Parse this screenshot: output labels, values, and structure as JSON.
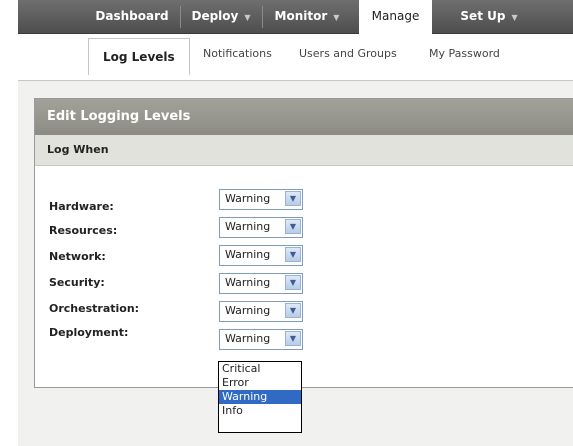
{
  "topnav": {
    "items": [
      {
        "label": "Dashboard",
        "arrow": ""
      },
      {
        "label": "Deploy",
        "arrow": "▼"
      },
      {
        "label": "Monitor",
        "arrow": "▼"
      },
      {
        "label": "Manage",
        "arrow": ""
      },
      {
        "label": "Set Up",
        "arrow": "▼"
      }
    ],
    "active": "Manage"
  },
  "subtabs": {
    "items": [
      "Log Levels",
      "Notifications",
      "Users and Groups",
      "My Password"
    ],
    "active": "Log Levels"
  },
  "panel": {
    "title": "Edit Logging Levels",
    "section": "Log When",
    "rows": [
      {
        "label": "Hardware:",
        "value": "Warning"
      },
      {
        "label": "Resources:",
        "value": "Warning"
      },
      {
        "label": "Network:",
        "value": "Warning"
      },
      {
        "label": "Security:",
        "value": "Warning"
      },
      {
        "label": "Orchestration:",
        "value": "Warning"
      },
      {
        "label": "Deployment:",
        "value": "Warning"
      }
    ]
  },
  "dropdown": {
    "options": [
      "Critical",
      "Error",
      "Warning",
      "Info"
    ],
    "highlighted": "Warning"
  },
  "colors": {
    "nav_bg": "#5e5e5e",
    "panel_header": "#999991",
    "highlight": "#316ac5"
  },
  "icons": {
    "select_arrow": "chevron-down-icon"
  }
}
